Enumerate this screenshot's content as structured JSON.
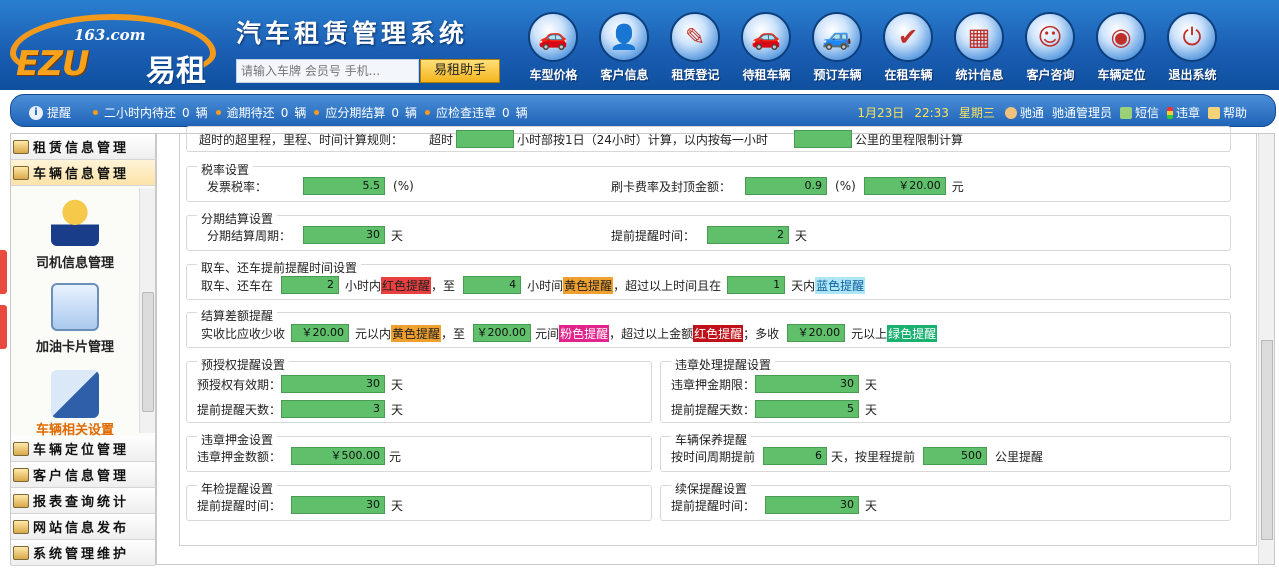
{
  "header": {
    "logo_domain": "163.com",
    "logo_brand": "EZU",
    "logo_brand_cn": "易租",
    "system_title": "汽车租赁管理系统",
    "search_placeholder": "请输入车牌 会员号 手机...",
    "search_button": "易租助手"
  },
  "nav": [
    {
      "label": "车型价格",
      "icon": "car-icon"
    },
    {
      "label": "客户信息",
      "icon": "customer-icon"
    },
    {
      "label": "租赁登记",
      "icon": "register-icon"
    },
    {
      "label": "待租车辆",
      "icon": "car-icon"
    },
    {
      "label": "预订车辆",
      "icon": "car-icon"
    },
    {
      "label": "在租车辆",
      "icon": "car-check-icon"
    },
    {
      "label": "统计信息",
      "icon": "chart-icon"
    },
    {
      "label": "客户咨询",
      "icon": "consult-icon"
    },
    {
      "label": "车辆定位",
      "icon": "globe-icon"
    },
    {
      "label": "退出系统",
      "icon": "exit-icon"
    }
  ],
  "infobar": {
    "remind_label": "提醒",
    "counters": [
      {
        "label": "二小时内待还",
        "count": "0",
        "unit": "辆"
      },
      {
        "label": "逾期待还",
        "count": "0",
        "unit": "辆"
      },
      {
        "label": "应分期结算",
        "count": "0",
        "unit": "辆"
      },
      {
        "label": "应检查违章",
        "count": "0",
        "unit": "辆"
      }
    ],
    "date": "1月23日",
    "time": "22:33",
    "weekday": "星期三",
    "user": "驰通",
    "role": "驰通管理员",
    "sms": "短信",
    "violation": "违章",
    "help": "帮助"
  },
  "sidebar": {
    "top_items": [
      "租赁信息管理",
      "车辆信息管理"
    ],
    "sub_items": [
      "司机信息管理",
      "加油卡片管理",
      "车辆相关设置"
    ],
    "bottom_items": [
      "车辆定位管理",
      "客户信息管理",
      "报表查询统计",
      "网站信息发布",
      "系统管理维护"
    ]
  },
  "content": {
    "clipped_row": {
      "text1": "超时的超里程，里程、时间计算规则：",
      "text2": "超时",
      "text3": "小时部按1日（24小时）计算，以内按每一小时",
      "text4": "公里的里程限制计算"
    },
    "tax": {
      "title": "税率设置",
      "invoice_label": "发票税率：",
      "invoice_value": "5.5",
      "invoice_unit": "(%)",
      "card_label": "刷卡费率及封顶金额：",
      "card_rate": "0.9",
      "card_unit": "(%)",
      "card_cap": "￥20.00",
      "cap_unit": "元"
    },
    "installment": {
      "title": "分期结算设置",
      "period_label": "分期结算周期：",
      "period_value": "30",
      "period_unit": "天",
      "remind_label": "提前提醒时间：",
      "remind_value": "2",
      "remind_unit": "天"
    },
    "pickup": {
      "title": "取车、还车提前提醒时间设置",
      "t1": "取车、还车在",
      "v1": "2",
      "t2": "小时内",
      "tag_red": "红色提醒",
      "t3": "，至",
      "v2": "4",
      "t4": "小时间",
      "tag_yellow": "黄色提醒",
      "t5": "，超过以上时间且在",
      "v3": "1",
      "t6": "天内",
      "tag_blue": "蓝色提醒"
    },
    "settle": {
      "title": "结算差额提醒",
      "t1": "实收比应收少收",
      "v1": "￥20.00",
      "t2": "元以内",
      "tag_yellow": "黄色提醒",
      "t3": "，至",
      "v2": "￥200.00",
      "t4": "元间",
      "tag_pink": "粉色提醒",
      "t5": "，超过以上金额",
      "tag_red": "红色提醒",
      "t6": "；多收",
      "v3": "￥20.00",
      "t7": "元以上",
      "tag_green": "绿色提醒"
    },
    "preauth": {
      "title": "预授权提醒设置",
      "valid_label": "预授权有效期：",
      "valid_value": "30",
      "valid_unit": "天",
      "days_label": "提前提醒天数：",
      "days_value": "3",
      "days_unit": "天"
    },
    "violation_remind": {
      "title": "违章处理提醒设置",
      "deposit_label": "违章押金期限：",
      "deposit_value": "30",
      "deposit_unit": "天",
      "days_label": "提前提醒天数：",
      "days_value": "5",
      "days_unit": "天"
    },
    "violation_deposit": {
      "title": "违章押金设置",
      "amount_label": "违章押金数额：",
      "amount_value": "￥500.00",
      "amount_unit": "元"
    },
    "maintenance": {
      "title": "车辆保养提醒",
      "t1": "按时间周期提前",
      "v1": "6",
      "t2": "天，按里程提前",
      "v2": "500",
      "t3": "公里提醒"
    },
    "annual": {
      "title": "年检提醒设置",
      "label": "提前提醒时间：",
      "value": "30",
      "unit": "天"
    },
    "insurance": {
      "title": "续保提醒设置",
      "label": "提前提醒时间：",
      "value": "30",
      "unit": "天"
    }
  }
}
